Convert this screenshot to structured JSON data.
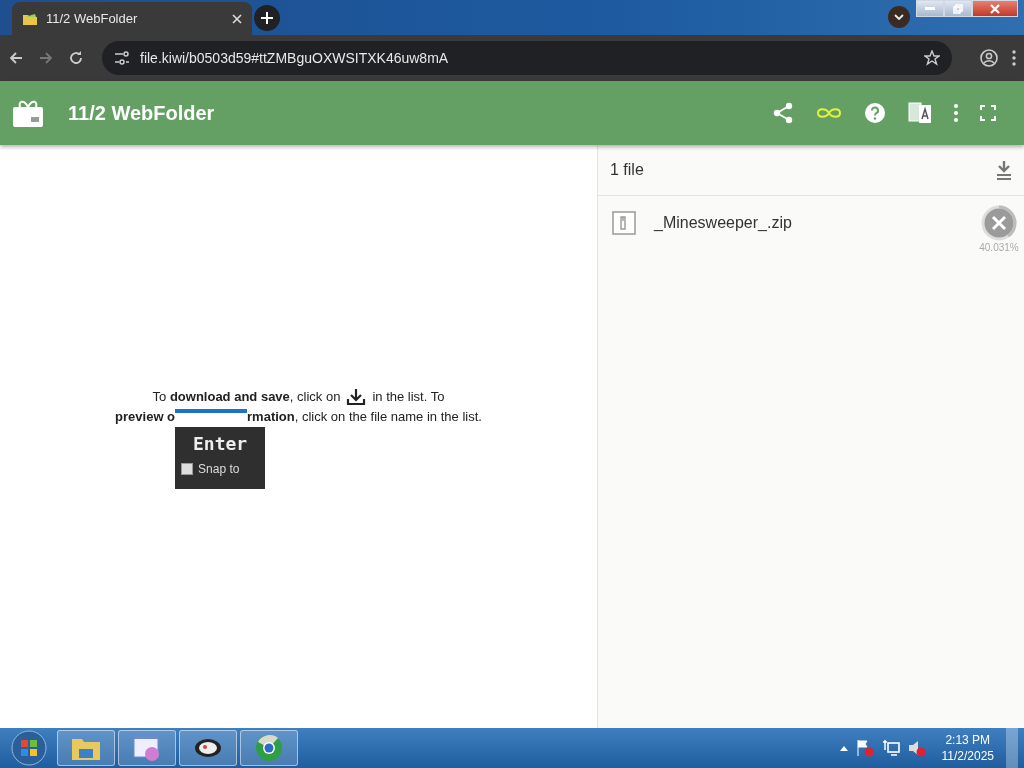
{
  "browser": {
    "tab": {
      "title": "11/2 WebFolder",
      "selected": true
    },
    "url": "file.kiwi/b0503d59#ttZMBguOXWSITXK46uw8mA"
  },
  "app": {
    "title": "11/2 WebFolder"
  },
  "instructions": {
    "line_1": "To **download and save**, click on",
    "line_1_end": "in the list. To",
    "line_2_start": "preview o",
    "line_2_end": "**rmation**, click on the file name in the list."
  },
  "popup": {
    "title": "Enter",
    "checkbox": {
      "label": "Snap to",
      "checked": false
    }
  },
  "files": {
    "count": "1 file",
    "items": [
      {
        "name": "_Minesweeper_.zip",
        "progress": "40.031%",
        "level": 0.40031
      }
    ]
  },
  "taskbar": {
    "time": "2:13 PM",
    "date": "11/2/2025"
  }
}
